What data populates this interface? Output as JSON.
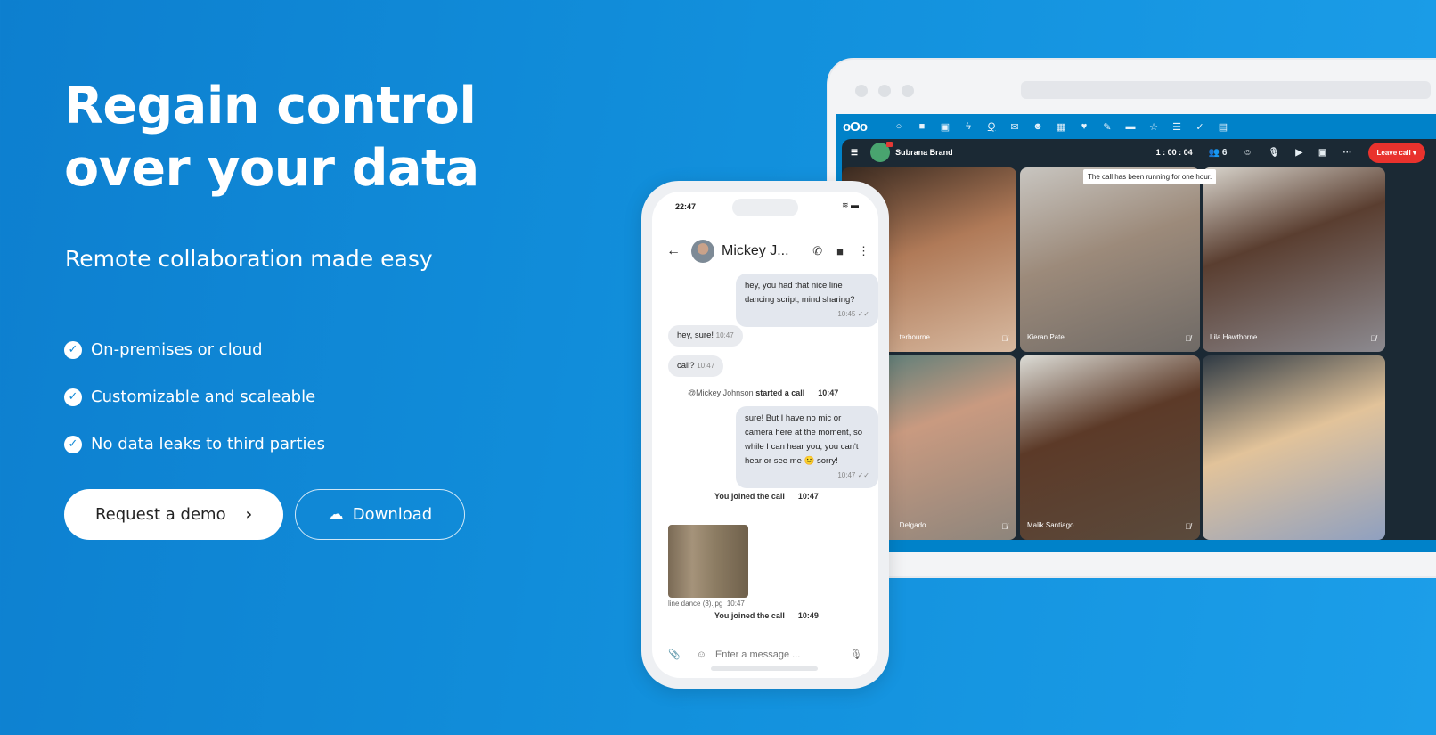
{
  "hero": {
    "title_line1": "Regain control",
    "title_line2": "over your data",
    "subtitle": "Remote collaboration made easy",
    "features": [
      "On-premises or cloud",
      "Customizable and scaleable",
      "No data leaks to third parties"
    ],
    "demo_button": "Request a demo",
    "download_button": "Download"
  },
  "call": {
    "room": "Subrana Brand",
    "timer": "1 : 00 : 04",
    "participants": "6",
    "leave": "Leave call",
    "tooltip": "The call has been running for one hour.",
    "tiles": [
      {
        "name": "...terbourne",
        "muted": true
      },
      {
        "name": "Kieran Patel",
        "muted": true
      },
      {
        "name": "Lila Hawthorne",
        "muted": true
      },
      {
        "name": "...Delgado",
        "muted": true
      },
      {
        "name": "Malik Santiago",
        "muted": true
      },
      {
        "name": "",
        "muted": false
      }
    ]
  },
  "phone": {
    "time": "22:47",
    "contact": "Mickey J...",
    "messages": [
      {
        "text": "hey, you had that nice line dancing script, mind sharing?",
        "time": "10:45"
      },
      {
        "text": "hey, sure!",
        "time": "10:47"
      },
      {
        "text": "call?",
        "time": "10:47"
      },
      {
        "text": "sure! But I have no mic or camera here at the moment, so while I can hear you, you can't hear or see me 🙂 sorry!",
        "time": "10:47"
      }
    ],
    "system": [
      {
        "user": "@Mickey Johnson",
        "text": "started a call",
        "time": "10:47"
      },
      {
        "text": "You joined the call",
        "time": "10:47"
      },
      {
        "text": "You joined the call",
        "time": "10:49"
      }
    ],
    "image_caption": "line dance (3).jpg",
    "image_time": "10:47",
    "input_placeholder": "Enter a message ..."
  },
  "colors": {
    "accent": "#0082c9",
    "leave": "#e9322d"
  }
}
